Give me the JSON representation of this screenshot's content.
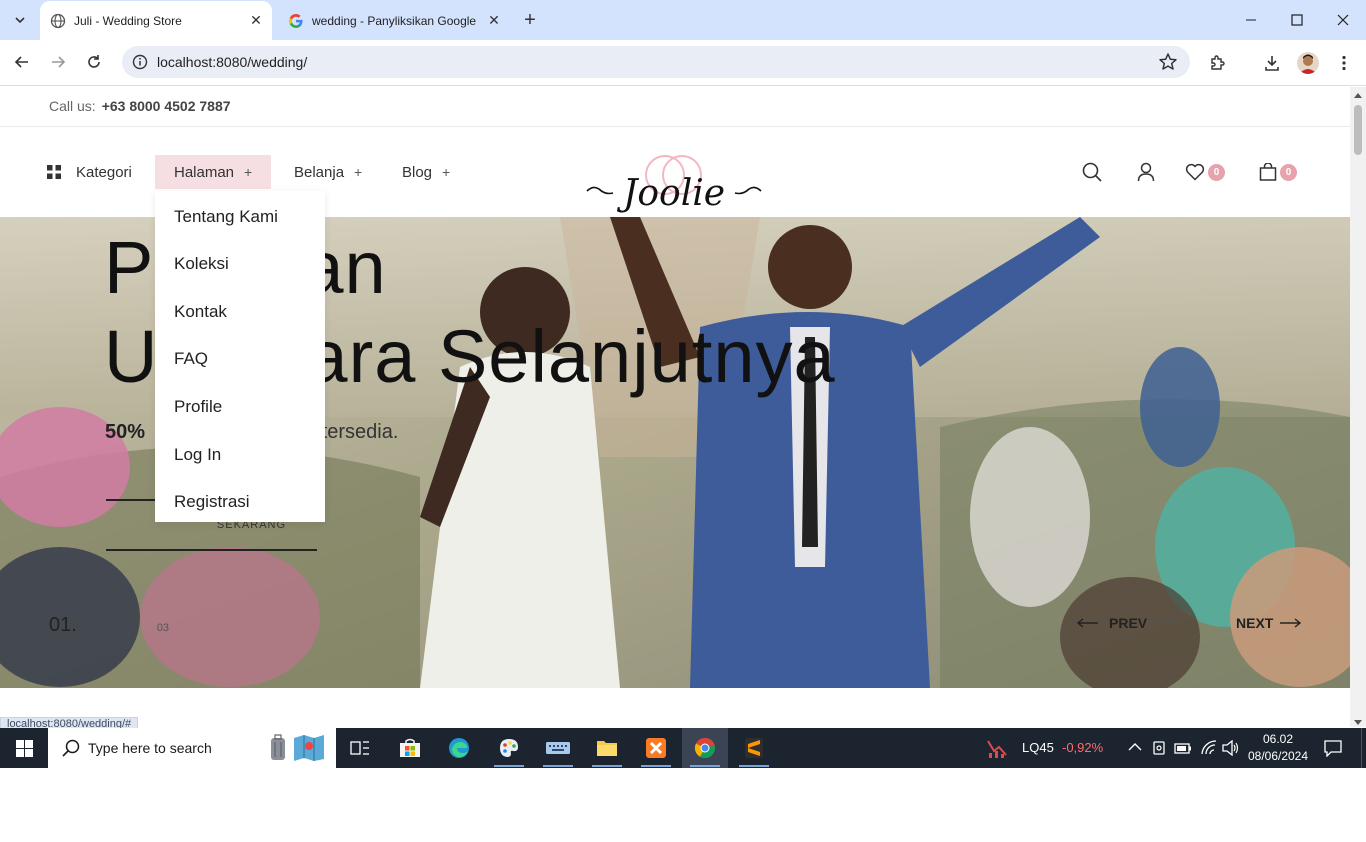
{
  "browser": {
    "tabs": [
      {
        "title": "Juli - Wedding Store",
        "active": true
      },
      {
        "title": "wedding - Panyliksikan Google",
        "active": false
      }
    ],
    "url": "localhost:8080/wedding/",
    "status_url": "localhost:8080/wedding/#"
  },
  "topbar": {
    "call_label": "Call us:",
    "phone": "+63 8000 4502 7887"
  },
  "nav": {
    "items": [
      {
        "label": "Kategori",
        "plus": ""
      },
      {
        "label": "Halaman",
        "plus": "+"
      },
      {
        "label": "Belanja",
        "plus": "+"
      },
      {
        "label": "Blog",
        "plus": "+"
      }
    ],
    "wishlist_count": "0",
    "cart_count": "0"
  },
  "logo": {
    "text": "Joolie"
  },
  "dropdown": {
    "items": [
      "Tentang Kami",
      "Koleksi",
      "Kontak",
      "FAQ",
      "Profile",
      "Log In",
      "Registrasi"
    ]
  },
  "hero": {
    "title_line1": "Pe        ahan",
    "title_line2": "Up      Acara Selanjutnya",
    "subtitle_pct": "50%",
    "subtitle_rest": "uk tersedia.",
    "button": "SEKARANG",
    "slide_current": "01.",
    "slide_total": "03",
    "prev": "PREV",
    "next": "NEXT"
  },
  "taskbar": {
    "search_placeholder": "Type here to search",
    "stock_name": "LQ45",
    "stock_change": "-0,92%",
    "time": "06.02",
    "date": "08/06/2024"
  },
  "colors": {
    "accent_pink": "#f6dfe3",
    "badge": "#e8a2ad",
    "stock_down": "#ff6b6b"
  }
}
